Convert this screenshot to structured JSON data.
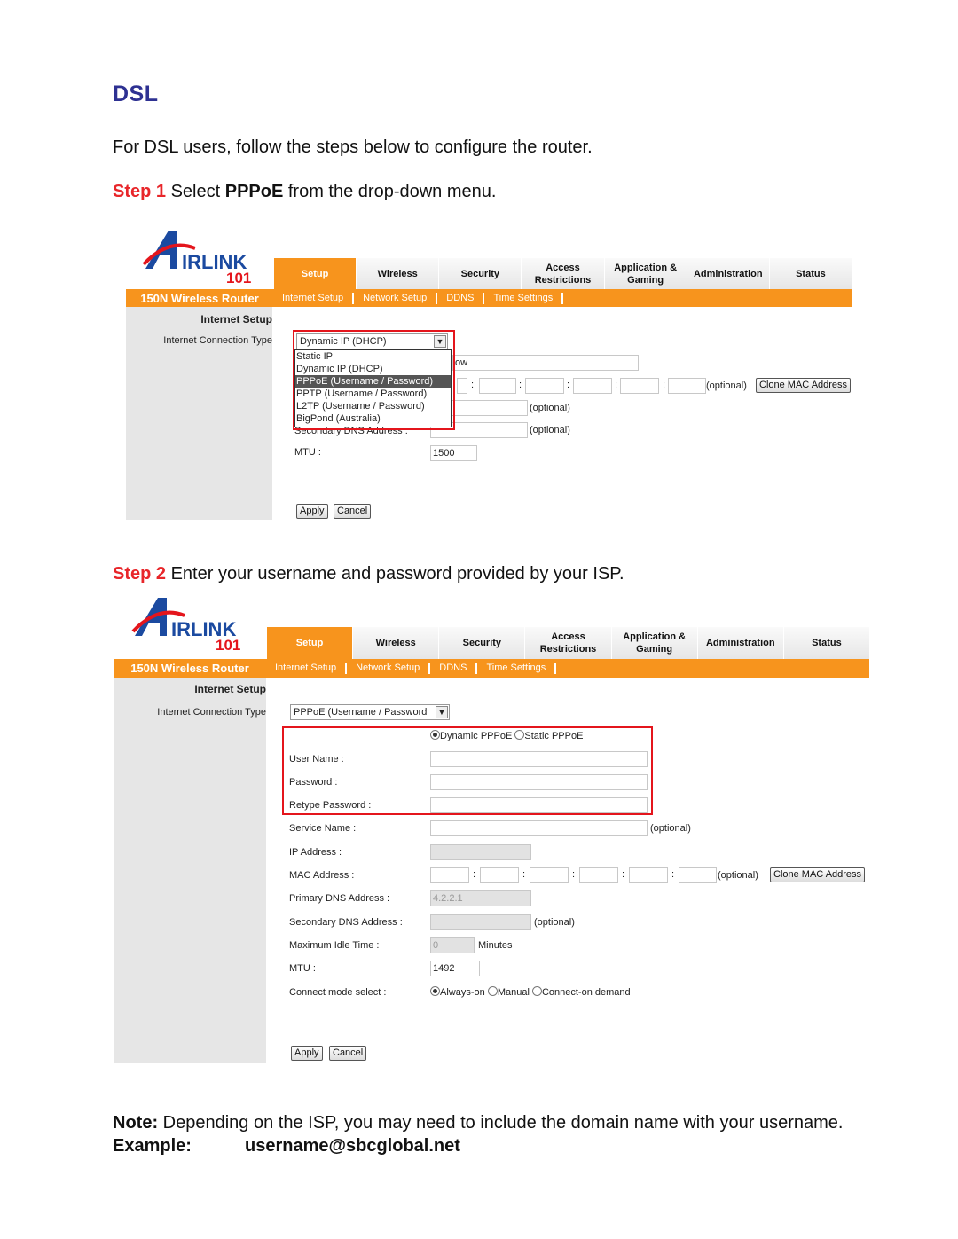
{
  "heading": "DSL",
  "intro": "For DSL users, follow the steps below to configure the router.",
  "step1": {
    "label": "Step 1",
    "pre": " Select ",
    "bold": "PPPoE",
    "post": " from the drop-down menu."
  },
  "step2": {
    "label": "Step 2",
    "text": " Enter your username and password provided by your ISP."
  },
  "note": {
    "label": "Note:",
    "text": " Depending on the ISP, you may need to include the domain name with your username."
  },
  "example": {
    "label": "Example:",
    "value": "username@sbcglobal.net"
  },
  "colors": {
    "heading": "#2e3192",
    "step": "#e8262a",
    "orange": "#f7941d",
    "highlight_box": "#e4151c"
  },
  "router": {
    "logo": "AirLink 101",
    "product": "150N Wireless Router",
    "tabs": [
      "Setup",
      "Wireless",
      "Security",
      "Access Restrictions",
      "Application & Gaming",
      "Administration",
      "Status"
    ],
    "active_tab": "Setup",
    "subtabs": [
      "Internet Setup",
      "Network Setup",
      "DDNS",
      "Time Settings"
    ],
    "section_title": "Internet Setup",
    "connection_type_label": "Internet Connection Type",
    "apply": "Apply",
    "cancel": "Cancel",
    "clone_mac": "Clone MAC Address",
    "optional": "(optional)"
  },
  "screen1": {
    "select_value": "Dynamic IP (DHCP)",
    "options": [
      "Static IP",
      "Dynamic IP (DHCP)",
      "PPPoE (Username / Password)",
      "PPTP (Username / Password)",
      "L2TP (Username / Password)",
      "BigPond (Australia)"
    ],
    "highlighted_option": "PPPoE (Username / Password)",
    "hidden_field_value": "ow",
    "secondary_dns_label": "Secondary DNS Address :",
    "mtu_label": "MTU :",
    "mtu_value": "1500"
  },
  "screen2": {
    "select_value": "PPPoE (Username / Password",
    "pppoe_modes": [
      "Dynamic PPPoE",
      "Static PPPoE"
    ],
    "pppoe_mode_selected": "Dynamic PPPoE",
    "labels": {
      "user_name": "User Name :",
      "password": "Password :",
      "retype": "Retype Password :",
      "service": "Service Name :",
      "ip": "IP Address :",
      "mac": "MAC Address :",
      "primary_dns": "Primary DNS Address :",
      "secondary_dns": "Secondary DNS Address :",
      "idle": "Maximum Idle Time :",
      "mtu": "MTU :",
      "connect_mode": "Connect mode select :"
    },
    "primary_dns_value": "4.2.2.1",
    "idle_value": "0",
    "idle_unit": "Minutes",
    "mtu_value": "1492",
    "connect_modes": [
      "Always-on",
      "Manual",
      "Connect-on demand"
    ],
    "connect_mode_selected": "Always-on"
  }
}
